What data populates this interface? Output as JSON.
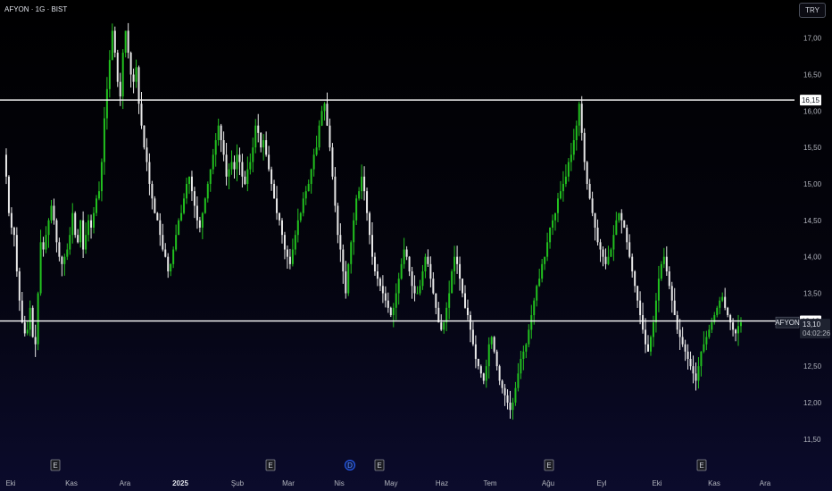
{
  "header": {
    "symbol": "AFYON · 1G · BIST"
  },
  "toolbar": {
    "currency_label": "TRY"
  },
  "colors": {
    "up": "#22c11f",
    "down": "#e8e8e8",
    "level_line": "#ffffff",
    "axis_text": "#b2b5be"
  },
  "chart_data": {
    "type": "candlestick",
    "symbol_label": "AFYON",
    "ylim": [
      11.4,
      17.4
    ],
    "yticks": [
      "11,50",
      "12,00",
      "12,50",
      "13,00",
      "13,50",
      "14,00",
      "14,50",
      "15,00",
      "15,50",
      "16,00",
      "16,50",
      "17,00"
    ],
    "xticks": [
      "Eki",
      "Kas",
      "Ara",
      "2025",
      "Şub",
      "Mar",
      "Nis",
      "May",
      "Haz",
      "Tem",
      "Ağu",
      "Eyl",
      "Eki",
      "Kas",
      "Ara"
    ],
    "grid": false,
    "horizontal_lines": [
      {
        "value": 16.15,
        "label": "16,15"
      },
      {
        "value": 13.12,
        "label": "13,12"
      }
    ],
    "last_price": {
      "value": 13.1,
      "label": "13,10",
      "countdown": "04:02:26"
    },
    "event_markers": [
      {
        "month": "Kas",
        "label": "E",
        "kind": "earnings"
      },
      {
        "month": "Mar",
        "label": "E",
        "kind": "earnings"
      },
      {
        "month": "Mar-late",
        "label": "D",
        "kind": "dividend"
      },
      {
        "month": "Nis",
        "label": "E",
        "kind": "earnings"
      },
      {
        "month": "Ağu",
        "label": "E",
        "kind": "earnings"
      },
      {
        "month": "Kas",
        "label": "E",
        "kind": "earnings"
      }
    ],
    "close_path": [
      15.4,
      15.1,
      14.6,
      14.4,
      14.3,
      13.8,
      13.4,
      13.1,
      12.95,
      13.0,
      13.3,
      12.9,
      12.8,
      13.5,
      14.2,
      14.1,
      14.3,
      14.5,
      14.7,
      14.5,
      14.2,
      14.0,
      13.9,
      14.0,
      14.1,
      14.3,
      14.6,
      14.3,
      14.2,
      14.5,
      14.1,
      14.3,
      14.5,
      14.4,
      14.6,
      14.8,
      14.9,
      15.3,
      15.9,
      16.3,
      16.7,
      17.1,
      16.8,
      16.4,
      16.2,
      16.8,
      17.1,
      16.8,
      16.5,
      16.4,
      16.6,
      16.1,
      15.8,
      15.5,
      15.3,
      15.0,
      14.8,
      14.6,
      14.5,
      14.3,
      14.1,
      14.0,
      13.8,
      13.9,
      14.1,
      14.3,
      14.5,
      14.6,
      14.8,
      15.0,
      15.1,
      14.9,
      14.7,
      14.5,
      14.4,
      14.6,
      14.8,
      15.0,
      15.2,
      15.4,
      15.6,
      15.8,
      15.6,
      15.4,
      15.1,
      15.2,
      15.3,
      15.2,
      15.4,
      15.3,
      15.1,
      15.0,
      15.2,
      15.3,
      15.5,
      15.8,
      15.7,
      15.5,
      15.6,
      15.4,
      15.2,
      15.0,
      14.8,
      14.6,
      14.5,
      14.3,
      14.1,
      14.0,
      13.9,
      14.1,
      14.3,
      14.5,
      14.6,
      14.8,
      14.9,
      15.0,
      15.2,
      15.4,
      15.5,
      15.8,
      16.0,
      16.1,
      15.8,
      15.5,
      15.1,
      14.7,
      14.3,
      14.1,
      13.8,
      13.5,
      13.9,
      14.2,
      14.5,
      14.8,
      14.9,
      15.1,
      14.9,
      14.6,
      14.3,
      14.0,
      13.8,
      13.7,
      13.6,
      13.5,
      13.4,
      13.3,
      13.2,
      13.3,
      13.5,
      13.7,
      13.9,
      14.1,
      14.0,
      13.8,
      13.6,
      13.5,
      13.5,
      13.6,
      13.8,
      14.0,
      13.9,
      13.7,
      13.5,
      13.3,
      13.1,
      13.0,
      13.1,
      13.3,
      13.5,
      13.8,
      14.0,
      13.9,
      13.7,
      13.5,
      13.3,
      13.2,
      13.0,
      12.8,
      12.6,
      12.5,
      12.4,
      12.3,
      12.5,
      12.8,
      12.9,
      12.7,
      12.5,
      12.3,
      12.2,
      12.1,
      12.0,
      11.9,
      12.0,
      12.2,
      12.4,
      12.6,
      12.7,
      12.8,
      13.0,
      13.2,
      13.4,
      13.6,
      13.7,
      13.9,
      14.0,
      14.2,
      14.4,
      14.5,
      14.6,
      14.8,
      14.9,
      15.0,
      15.1,
      15.3,
      15.4,
      15.6,
      15.8,
      16.1,
      15.7,
      15.3,
      15.0,
      14.8,
      14.6,
      14.4,
      14.2,
      14.1,
      14.0,
      13.9,
      14.0,
      14.1,
      14.3,
      14.5,
      14.6,
      14.5,
      14.4,
      14.2,
      14.0,
      13.8,
      13.6,
      13.4,
      13.2,
      13.0,
      12.8,
      12.7,
      12.9,
      13.1,
      13.4,
      13.7,
      13.9,
      14.0,
      13.8,
      13.6,
      13.4,
      13.2,
      13.0,
      12.9,
      12.8,
      12.7,
      12.6,
      12.5,
      12.4,
      12.3,
      12.5,
      12.7,
      12.8,
      12.9,
      13.0,
      13.1,
      13.2,
      13.3,
      13.4,
      13.45,
      13.3,
      13.2,
      13.1,
      13.0,
      12.95,
      13.05,
      13.1
    ]
  }
}
